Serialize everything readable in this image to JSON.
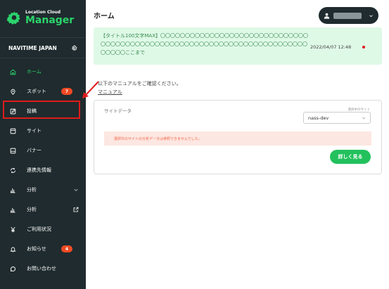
{
  "sidebar": {
    "logo_small": "Location Cloud",
    "logo_big": "Manager",
    "company_name": "NAVITIME JAPAN",
    "items": [
      {
        "label": "ホーム",
        "icon": "home-icon",
        "active": true
      },
      {
        "label": "スポット",
        "icon": "pin-icon",
        "badge": "7"
      },
      {
        "label": "投稿",
        "icon": "edit-icon"
      },
      {
        "label": "サイト",
        "icon": "window-icon"
      },
      {
        "label": "バナー",
        "icon": "banner-icon"
      },
      {
        "label": "連携先情報",
        "icon": "sync-icon"
      },
      {
        "label": "分析",
        "icon": "bar-chart-icon",
        "trail": "chevron-down-icon"
      },
      {
        "label": "分析",
        "icon": "bar-chart-icon",
        "trail": "external-link-icon"
      },
      {
        "label": "ご利用状況",
        "icon": "yen-icon"
      },
      {
        "label": "お知らせ",
        "icon": "bell-icon",
        "badge": "4"
      },
      {
        "label": "お問い合わせ",
        "icon": "chat-icon"
      }
    ]
  },
  "header": {
    "title": "ホーム"
  },
  "notice": {
    "text": "【タイトル100文字MAX】〇〇〇〇〇〇〇〇〇〇〇〇〇〇〇〇〇〇〇〇〇〇〇〇〇〇〇〇〇〇〇〇〇〇〇〇〇〇〇〇〇〇〇〇〇〇〇〇〇〇〇〇〇〇〇〇〇〇〇〇〇〇〇〇〇〇〇〇〇〇〇〇〇〇〇〇〇ここまで",
    "date": "2022/04/07 12:48"
  },
  "main": {
    "manual_line": "以下のマニュアルをご確認ください。",
    "manual_link": "マニュアル"
  },
  "card": {
    "title": "サイトデータ",
    "site_label": "選択中のサイト",
    "site_value": "nass-dev",
    "warning": "選択中のサイトの分析データは参照できませんでした。",
    "detail_button": "詳しく見る"
  },
  "colors": {
    "sidebar_bg": "#1f2b2e",
    "accent": "#2bd46b",
    "badge": "#f04a23",
    "highlight": "#e01b1b",
    "notice_bg": "#dff9e7",
    "button": "#22c15d"
  }
}
